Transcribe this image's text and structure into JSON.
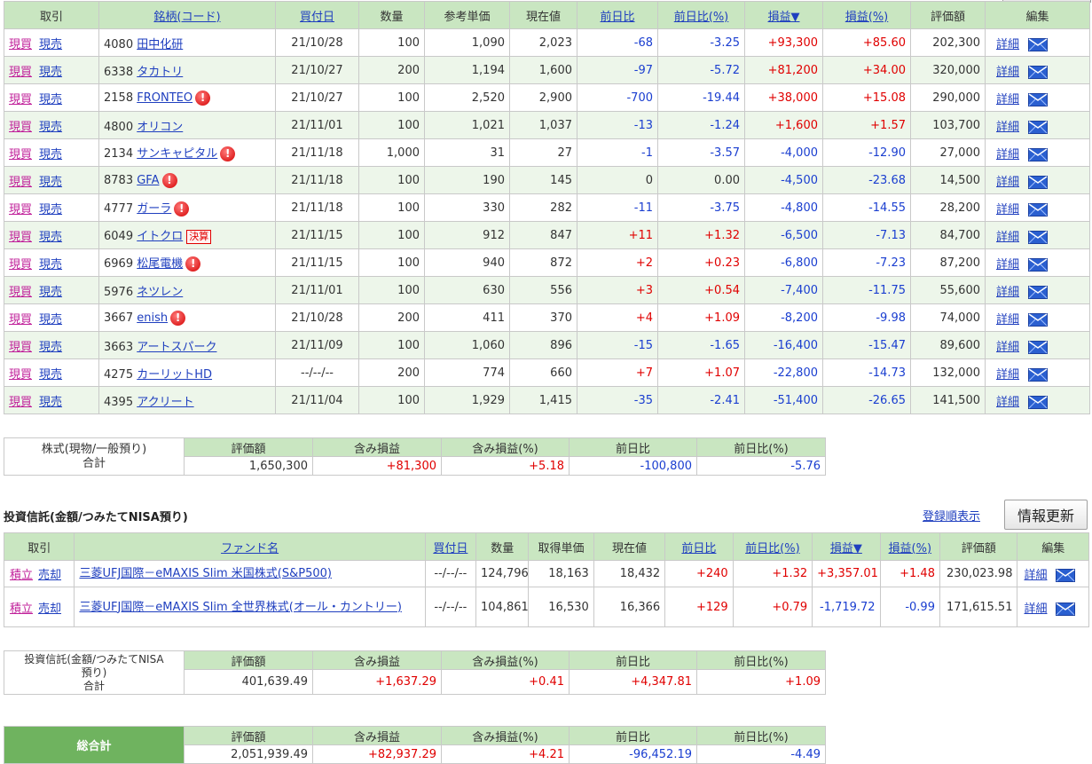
{
  "stocks": {
    "headers": {
      "trade": "取引",
      "name": "銘柄(コード)",
      "date": "買付日",
      "qty": "数量",
      "ref_price": "参考単価",
      "price": "現在値",
      "change": "前日比",
      "change_pct": "前日比(%)",
      "pl": "損益▼",
      "pl_pct": "損益(%)",
      "value": "評価額",
      "edit": "編集"
    },
    "trade_labels": {
      "buy": "現買",
      "sell": "現売"
    },
    "detail_label": "詳細",
    "rows": [
      {
        "code": "4080",
        "name": "田中化研",
        "alert": false,
        "badge": "",
        "date": "21/10/28",
        "qty": "100",
        "ref_price": "1,090",
        "price": "2,023",
        "change": "-68",
        "change_pct": "-3.25",
        "pl": "+93,300",
        "pl_pct": "+85.60",
        "value": "202,300"
      },
      {
        "code": "6338",
        "name": "タカトリ",
        "alert": false,
        "badge": "",
        "date": "21/10/27",
        "qty": "200",
        "ref_price": "1,194",
        "price": "1,600",
        "change": "-97",
        "change_pct": "-5.72",
        "pl": "+81,200",
        "pl_pct": "+34.00",
        "value": "320,000"
      },
      {
        "code": "2158",
        "name": "FRONTEO",
        "alert": true,
        "badge": "",
        "date": "21/10/27",
        "qty": "100",
        "ref_price": "2,520",
        "price": "2,900",
        "change": "-700",
        "change_pct": "-19.44",
        "pl": "+38,000",
        "pl_pct": "+15.08",
        "value": "290,000"
      },
      {
        "code": "4800",
        "name": "オリコン",
        "alert": false,
        "badge": "",
        "date": "21/11/01",
        "qty": "100",
        "ref_price": "1,021",
        "price": "1,037",
        "change": "-13",
        "change_pct": "-1.24",
        "pl": "+1,600",
        "pl_pct": "+1.57",
        "value": "103,700"
      },
      {
        "code": "2134",
        "name": "サンキャピタル",
        "alert": true,
        "badge": "",
        "date": "21/11/18",
        "qty": "1,000",
        "ref_price": "31",
        "price": "27",
        "change": "-1",
        "change_pct": "-3.57",
        "pl": "-4,000",
        "pl_pct": "-12.90",
        "value": "27,000"
      },
      {
        "code": "8783",
        "name": "GFA",
        "alert": true,
        "badge": "",
        "date": "21/11/18",
        "qty": "100",
        "ref_price": "190",
        "price": "145",
        "change": "0",
        "change_pct": "0.00",
        "pl": "-4,500",
        "pl_pct": "-23.68",
        "value": "14,500"
      },
      {
        "code": "4777",
        "name": "ガーラ",
        "alert": true,
        "badge": "",
        "date": "21/11/18",
        "qty": "100",
        "ref_price": "330",
        "price": "282",
        "change": "-11",
        "change_pct": "-3.75",
        "pl": "-4,800",
        "pl_pct": "-14.55",
        "value": "28,200"
      },
      {
        "code": "6049",
        "name": "イトクロ",
        "alert": false,
        "badge": "決算",
        "date": "21/11/15",
        "qty": "100",
        "ref_price": "912",
        "price": "847",
        "change": "+11",
        "change_pct": "+1.32",
        "pl": "-6,500",
        "pl_pct": "-7.13",
        "value": "84,700"
      },
      {
        "code": "6969",
        "name": "松尾電機",
        "alert": true,
        "badge": "",
        "date": "21/11/15",
        "qty": "100",
        "ref_price": "940",
        "price": "872",
        "change": "+2",
        "change_pct": "+0.23",
        "pl": "-6,800",
        "pl_pct": "-7.23",
        "value": "87,200"
      },
      {
        "code": "5976",
        "name": "ネツレン",
        "alert": false,
        "badge": "",
        "date": "21/11/01",
        "qty": "100",
        "ref_price": "630",
        "price": "556",
        "change": "+3",
        "change_pct": "+0.54",
        "pl": "-7,400",
        "pl_pct": "-11.75",
        "value": "55,600"
      },
      {
        "code": "3667",
        "name": "enish",
        "alert": true,
        "badge": "",
        "date": "21/10/28",
        "qty": "200",
        "ref_price": "411",
        "price": "370",
        "change": "+4",
        "change_pct": "+1.09",
        "pl": "-8,200",
        "pl_pct": "-9.98",
        "value": "74,000"
      },
      {
        "code": "3663",
        "name": "アートスパーク",
        "alert": false,
        "badge": "",
        "date": "21/11/09",
        "qty": "100",
        "ref_price": "1,060",
        "price": "896",
        "change": "-15",
        "change_pct": "-1.65",
        "pl": "-16,400",
        "pl_pct": "-15.47",
        "value": "89,600"
      },
      {
        "code": "4275",
        "name": "カーリットHD",
        "alert": false,
        "badge": "",
        "date": "--/--/--",
        "qty": "200",
        "ref_price": "774",
        "price": "660",
        "change": "+7",
        "change_pct": "+1.07",
        "pl": "-22,800",
        "pl_pct": "-14.73",
        "value": "132,000"
      },
      {
        "code": "4395",
        "name": "アクリート",
        "alert": false,
        "badge": "",
        "date": "21/11/04",
        "qty": "100",
        "ref_price": "1,929",
        "price": "1,415",
        "change": "-35",
        "change_pct": "-2.41",
        "pl": "-51,400",
        "pl_pct": "-26.65",
        "value": "141,500"
      }
    ]
  },
  "stock_summary": {
    "label_line1": "株式(現物/一般預り)",
    "label_line2": "合計",
    "headers": [
      "評価額",
      "含み損益",
      "含み損益(%)",
      "前日比",
      "前日比(%)"
    ],
    "values": [
      "1,650,300",
      "+81,300",
      "+5.18",
      "-100,800",
      "-5.76"
    ]
  },
  "fund_section": {
    "title": "投資信託(金額/つみたてNISA預り)",
    "order_link": "登録順表示",
    "refresh_button": "情報更新"
  },
  "funds": {
    "headers": {
      "trade": "取引",
      "name": "ファンド名",
      "date": "買付日",
      "qty": "数量",
      "cost": "取得単価",
      "price": "現在値",
      "change": "前日比",
      "change_pct": "前日比(%)",
      "pl": "損益▼",
      "pl_pct": "損益(%)",
      "value": "評価額",
      "edit": "編集"
    },
    "trade_labels": {
      "buy": "積立",
      "sell": "売却"
    },
    "detail_label": "詳細",
    "rows": [
      {
        "name": "三菱UFJ国際－eMAXIS Slim 米国株式(S&P500)",
        "date": "--/--/--",
        "qty": "124,796",
        "cost": "18,163",
        "price": "18,432",
        "change": "+240",
        "change_pct": "+1.32",
        "pl": "+3,357.01",
        "pl_pct": "+1.48",
        "value": "230,023.98"
      },
      {
        "name": "三菱UFJ国際－eMAXIS Slim 全世界株式(オール・カントリー)",
        "date": "--/--/--",
        "qty": "104,861",
        "cost": "16,530",
        "price": "16,366",
        "change": "+129",
        "change_pct": "+0.79",
        "pl": "-1,719.72",
        "pl_pct": "-0.99",
        "value": "171,615.51"
      }
    ]
  },
  "fund_summary": {
    "label_line1": "投資信託(金額/つみたてNISA",
    "label_line2": "預り)",
    "label_line3": "合計",
    "headers": [
      "評価額",
      "含み損益",
      "含み損益(%)",
      "前日比",
      "前日比(%)"
    ],
    "values": [
      "401,639.49",
      "+1,637.29",
      "+0.41",
      "+4,347.81",
      "+1.09"
    ]
  },
  "grand_total": {
    "label": "総合計",
    "headers": [
      "評価額",
      "含み損益",
      "含み損益(%)",
      "前日比",
      "前日比(%)"
    ],
    "values": [
      "2,051,939.49",
      "+82,937.29",
      "+4.21",
      "-96,452.19",
      "-4.49"
    ]
  },
  "colors": {
    "header_green": "#c9e6c1",
    "row_stripe": "#edf6ea",
    "total_green": "#6fb35f",
    "positive": "#e00000",
    "negative": "#1a3ed0",
    "link": "#1f3fbf"
  },
  "icons": {
    "alert": "alert-icon",
    "mail": "mail-icon"
  }
}
